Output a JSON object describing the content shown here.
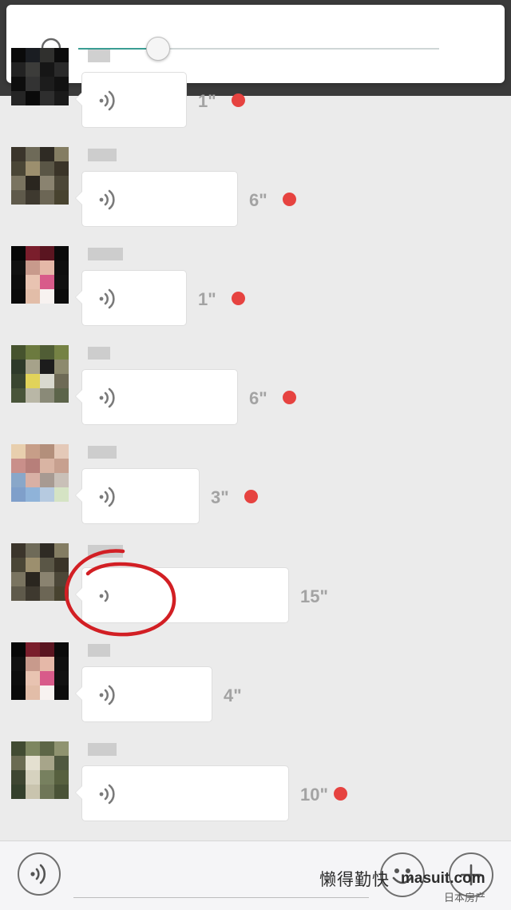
{
  "volume": {
    "level": 0.22,
    "icon": "headphones-icon",
    "accent_color": "#3a9d93"
  },
  "messages": [
    {
      "duration": "1\"",
      "unread": true,
      "bubble_width": 132,
      "avatar": 0
    },
    {
      "duration": "6\"",
      "unread": true,
      "bubble_width": 196,
      "avatar": 1
    },
    {
      "duration": "1\"",
      "unread": true,
      "bubble_width": 132,
      "avatar": 2
    },
    {
      "duration": "6\"",
      "unread": true,
      "bubble_width": 196,
      "avatar": 3
    },
    {
      "duration": "3\"",
      "unread": true,
      "bubble_width": 148,
      "avatar": 4
    },
    {
      "duration": "15\"",
      "unread": false,
      "bubble_width": 260,
      "avatar": 1,
      "highlighted": true
    },
    {
      "duration": "4\"",
      "unread": false,
      "bubble_width": 164,
      "avatar": 2
    },
    {
      "duration": "10\"",
      "unread": true,
      "bubble_width": 260,
      "avatar": 5
    }
  ],
  "bottom_bar": {
    "voice_icon": "voice-wave-icon",
    "emoji_icon": "smiley-icon",
    "plus_icon": "plus-icon"
  },
  "watermark": {
    "text_cn": "懒得勤快",
    "site": "masuit.com",
    "brand": "日本房产"
  },
  "colors": {
    "unread_dot": "#e64340",
    "duration_text": "#a3a3a3",
    "circle_annotation": "#d21f24"
  }
}
